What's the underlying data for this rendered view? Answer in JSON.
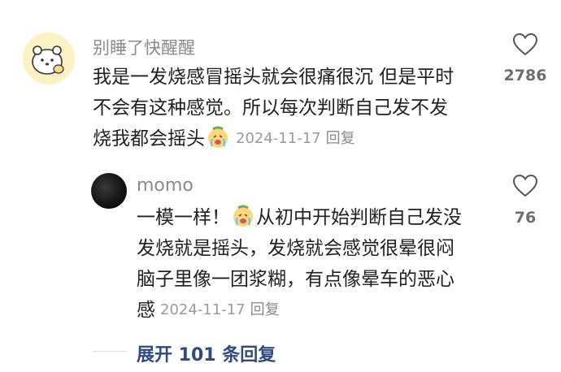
{
  "comment": {
    "username": "别睡了快醒醒",
    "lines": [
      "我是一发烧感冒摇头就会很痛很沉 但是平时",
      "不会有这种感觉。所以每次判断自己发不发",
      "烧我都会摇头"
    ],
    "date": "2024-11-17",
    "reply_label": "回复",
    "like_count": "2786",
    "like_icon": "heart-outline-icon"
  },
  "reply": {
    "username": "momo",
    "line1_before_emoji": "一模一样！",
    "line1_after_emoji": "从初中开始判断自己发没",
    "lines": [
      "发烧就是摇头，发烧就会感觉很晕很闷",
      "脑子里像一团浆糊，有点像晕车的恶心"
    ],
    "last_line": "感",
    "date": "2024-11-17",
    "reply_label": "回复",
    "like_count": "76",
    "like_icon": "heart-outline-icon"
  },
  "expand_replies": "展开 101 条回复",
  "colors": {
    "link": "#2f4a82",
    "meta": "#9a9a9a",
    "username": "#8a8a8a"
  }
}
